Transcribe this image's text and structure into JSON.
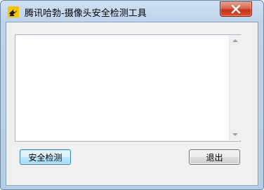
{
  "window": {
    "title": "腾讯哈勃-摄像头安全检测工具",
    "app_icon": "camera-tool-icon",
    "close_icon": "close-icon"
  },
  "output": {
    "text": ""
  },
  "buttons": {
    "detect_label": "安全检测",
    "exit_label": "退出"
  },
  "colors": {
    "close_button": "#c2341b",
    "focused_button_border": "#3c7fb1",
    "frame": "#b6cde6"
  }
}
